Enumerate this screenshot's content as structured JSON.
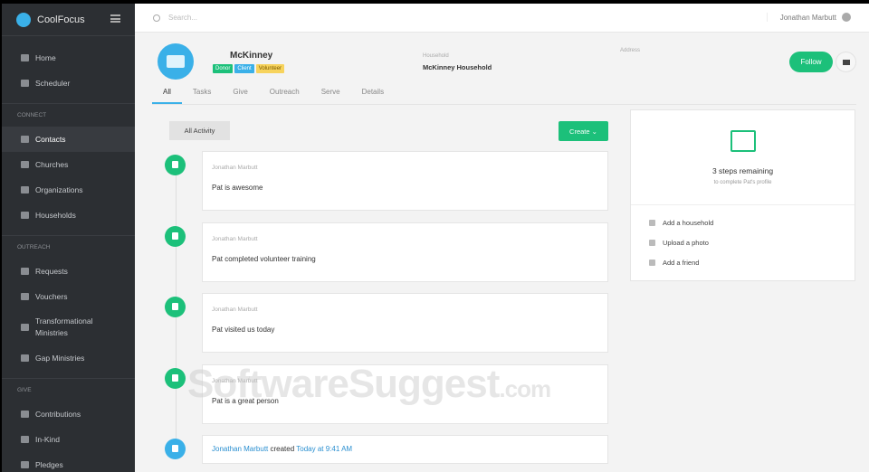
{
  "app": {
    "name": "CoolFocus"
  },
  "sidebar": {
    "top": [
      {
        "label": "Home"
      },
      {
        "label": "Scheduler"
      }
    ],
    "sections": [
      {
        "title": "CONNECT",
        "items": [
          {
            "label": "Contacts",
            "active": true
          },
          {
            "label": "Churches"
          },
          {
            "label": "Organizations"
          },
          {
            "label": "Households"
          }
        ]
      },
      {
        "title": "OUTREACH",
        "items": [
          {
            "label": "Requests"
          },
          {
            "label": "Vouchers"
          },
          {
            "label": "Transformational Ministries"
          },
          {
            "label": "Gap Ministries"
          }
        ]
      },
      {
        "title": "GIVE",
        "items": [
          {
            "label": "Contributions"
          },
          {
            "label": "In-Kind"
          },
          {
            "label": "Pledges"
          }
        ]
      }
    ]
  },
  "topbar": {
    "search_placeholder": "Search...",
    "user": "Jonathan Marbutt"
  },
  "profile": {
    "name": "McKinney",
    "tags": [
      {
        "label": "Donor",
        "color": "#1cc07a"
      },
      {
        "label": "Client",
        "color": "#3ab0e8"
      },
      {
        "label": "Volunteer",
        "color": "#f7d35c"
      }
    ],
    "household_label": "Household",
    "household": "McKinney Household",
    "address_label": "Address",
    "follow": "Follow"
  },
  "tabs": [
    "All",
    "Tasks",
    "Give",
    "Outreach",
    "Serve",
    "Details"
  ],
  "activity": {
    "filter": "All Activity",
    "create": "Create ⌄",
    "items": [
      {
        "author": "Jonathan Marbutt",
        "text": "Pat is awesome"
      },
      {
        "author": "Jonathan Marbutt",
        "text": "Pat completed volunteer training"
      },
      {
        "author": "Jonathan Marbutt",
        "text": "Pat visited us today"
      },
      {
        "author": "Jonathan Marbutt",
        "text": "Pat is a great person"
      }
    ],
    "created": {
      "author": "Jonathan Marbutt",
      "verb": " created ",
      "when": "Today at 9:41 AM"
    }
  },
  "panel": {
    "steps": "3 steps remaining",
    "sub": "to complete Pat's profile",
    "links": [
      "Add a household",
      "Upload a photo",
      "Add a friend"
    ]
  },
  "watermark": {
    "text": "SoftwareSuggest",
    "suffix": ".com"
  }
}
